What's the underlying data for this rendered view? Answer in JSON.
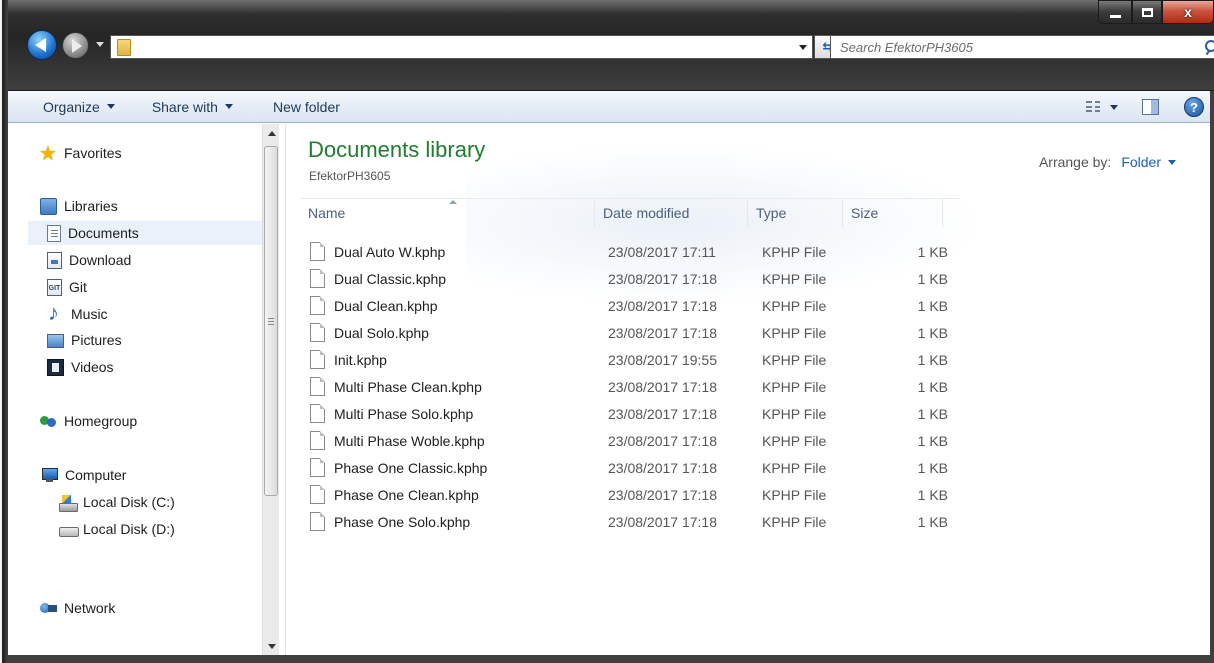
{
  "window": {
    "caption": {
      "minimize": "",
      "maximize": "",
      "close": "x"
    }
  },
  "address": {
    "path": ""
  },
  "search": {
    "placeholder": "Search EfektorPH3605"
  },
  "toolbar": {
    "organize_label": "Organize",
    "share_label": "Share with",
    "new_folder_label": "New folder",
    "help_label": "?"
  },
  "sidebar": {
    "favorites": "Favorites",
    "libraries": "Libraries",
    "items": [
      {
        "label": "Documents",
        "icon": "document-icon",
        "selected": true
      },
      {
        "label": "Download",
        "icon": "download-icon"
      },
      {
        "label": "Git",
        "icon": "git-icon",
        "icon_text": "GIT"
      },
      {
        "label": "Music",
        "icon": "music-icon"
      },
      {
        "label": "Pictures",
        "icon": "pictures-icon"
      },
      {
        "label": "Videos",
        "icon": "videos-icon"
      }
    ],
    "homegroup": "Homegroup",
    "computer": "Computer",
    "drives": [
      {
        "label": "Local Disk (C:)",
        "icon": "system-disk-icon"
      },
      {
        "label": "Local Disk (D:)",
        "icon": "disk-icon"
      }
    ],
    "network": "Network"
  },
  "library": {
    "title": "Documents library",
    "subtitle": "EfektorPH3605",
    "arrange_label": "Arrange by:",
    "arrange_value": "Folder"
  },
  "columns": {
    "name": "Name",
    "date": "Date modified",
    "type": "Type",
    "size": "Size"
  },
  "files": [
    {
      "name": "Dual Auto W.kphp",
      "date": "23/08/2017 17:11",
      "type": "KPHP File",
      "size": "1 KB"
    },
    {
      "name": "Dual Classic.kphp",
      "date": "23/08/2017 17:18",
      "type": "KPHP File",
      "size": "1 KB"
    },
    {
      "name": "Dual Clean.kphp",
      "date": "23/08/2017 17:18",
      "type": "KPHP File",
      "size": "1 KB"
    },
    {
      "name": "Dual Solo.kphp",
      "date": "23/08/2017 17:18",
      "type": "KPHP File",
      "size": "1 KB"
    },
    {
      "name": "Init.kphp",
      "date": "23/08/2017 19:55",
      "type": "KPHP File",
      "size": "1 KB"
    },
    {
      "name": "Multi Phase Clean.kphp",
      "date": "23/08/2017 17:18",
      "type": "KPHP File",
      "size": "1 KB"
    },
    {
      "name": "Multi Phase Solo.kphp",
      "date": "23/08/2017 17:18",
      "type": "KPHP File",
      "size": "1 KB"
    },
    {
      "name": "Multi Phase Woble.kphp",
      "date": "23/08/2017 17:18",
      "type": "KPHP File",
      "size": "1 KB"
    },
    {
      "name": "Phase One Classic.kphp",
      "date": "23/08/2017 17:18",
      "type": "KPHP File",
      "size": "1 KB"
    },
    {
      "name": "Phase One Clean.kphp",
      "date": "23/08/2017 17:18",
      "type": "KPHP File",
      "size": "1 KB"
    },
    {
      "name": "Phase One Solo.kphp",
      "date": "23/08/2017 17:18",
      "type": "KPHP File",
      "size": "1 KB"
    }
  ],
  "colors": {
    "library_title": "#1e7d2f",
    "link_blue": "#1d5fb3",
    "selected_bg": "#e9f1fb",
    "close_red": "#c9553d"
  }
}
